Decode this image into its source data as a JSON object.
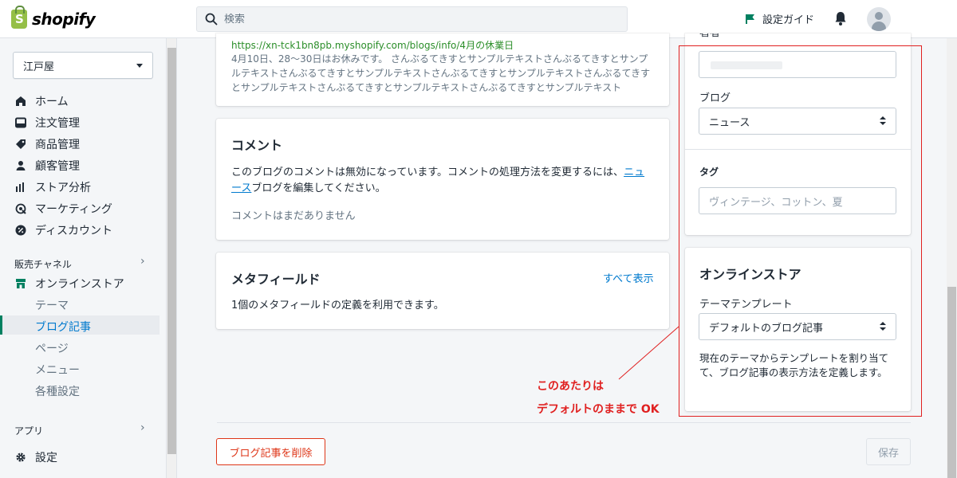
{
  "header": {
    "logo_text": "shopify",
    "logo_letter": "S",
    "search_placeholder": "検索",
    "guide_label": "設定ガイド"
  },
  "nav": {
    "store_name": "江戸屋",
    "items": [
      {
        "label": "ホーム",
        "icon": "home-icon"
      },
      {
        "label": "注文管理",
        "icon": "orders-icon"
      },
      {
        "label": "商品管理",
        "icon": "tag-icon"
      },
      {
        "label": "顧客管理",
        "icon": "customer-icon"
      },
      {
        "label": "ストア分析",
        "icon": "analytics-icon"
      },
      {
        "label": "マーケティング",
        "icon": "marketing-icon"
      },
      {
        "label": "ディスカウント",
        "icon": "discount-icon"
      }
    ],
    "sales_channels_label": "販売チャネル",
    "online_store_label": "オンラインストア",
    "sub_items": [
      "テーマ",
      "ブログ記事",
      "ページ",
      "メニュー",
      "各種設定"
    ],
    "apps_label": "アプリ",
    "settings_label": "設定"
  },
  "seo_preview": {
    "url": "https://xn-tck1bn8pb.myshopify.com/blogs/info/4月の休業日",
    "description": "4月10日、28〜30日はお休みです。 さんぶるてきすとサンプルテキストさんぶるてきすとサンプルテキストさんぶるてきすとサンプルテキストさんぶるてきすとサンプルテキストさんぶるてきすとサンプルテキストさんぶるてきすとサンプルテキストさんぶるてきすとサンプルテキスト"
  },
  "comments": {
    "title": "コメント",
    "text_before": "このブログのコメントは無効になっています。コメントの処理方法を変更するには、",
    "link": "ニュース",
    "text_after": "ブログを編集してください。",
    "empty": "コメントはまだありません"
  },
  "metafields": {
    "title": "メタフィールド",
    "show_all": "すべて表示",
    "text": "1個のメタフィールドの定義を利用できます。"
  },
  "organization": {
    "author_label": "著者",
    "blog_label": "ブログ",
    "blog_value": "ニュース",
    "tags_label": "タグ",
    "tags_placeholder": "ヴィンテージ、コットン、夏"
  },
  "online_store": {
    "title": "オンラインストア",
    "template_label": "テーマテンプレート",
    "template_value": "デフォルトのブログ記事",
    "help": "現在のテーマからテンプレートを割り当てて、ブログ記事の表示方法を定義します。"
  },
  "annotation": {
    "line1": "このあたりは",
    "line2": "デフォルトのままで OK",
    "color": "#e02020"
  },
  "actions": {
    "delete": "ブログ記事を削除",
    "save": "保存"
  }
}
